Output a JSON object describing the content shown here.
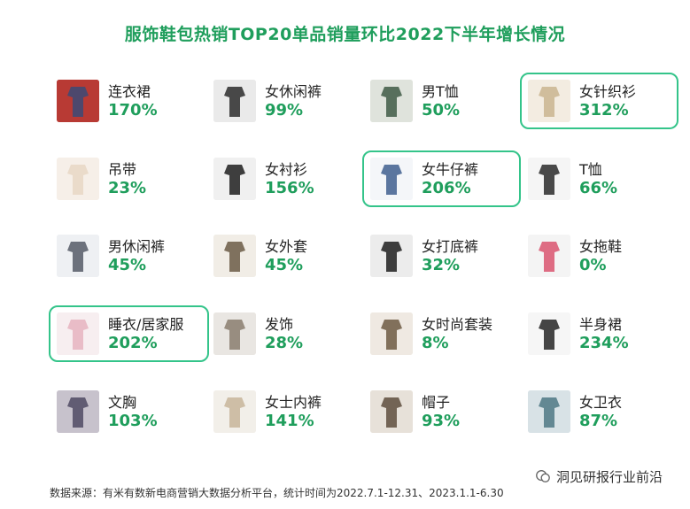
{
  "title": "服饰鞋包热销TOP20单品销量环比2022下半年增长情况",
  "chart_data": {
    "type": "table",
    "title": "服饰鞋包热销TOP20单品销量环比2022下半年增长情况",
    "items": [
      {
        "name": "连衣裙",
        "growth": "170%",
        "value": 170,
        "highlighted": false,
        "icon": "dress-icon"
      },
      {
        "name": "女休闲裤",
        "growth": "99%",
        "value": 99,
        "highlighted": false,
        "icon": "pants-icon"
      },
      {
        "name": "男T恤",
        "growth": "50%",
        "value": 50,
        "highlighted": false,
        "icon": "tshirt-icon"
      },
      {
        "name": "女针织衫",
        "growth": "312%",
        "value": 312,
        "highlighted": true,
        "icon": "knit-icon"
      },
      {
        "name": "吊带",
        "growth": "23%",
        "value": 23,
        "highlighted": false,
        "icon": "camisole-icon"
      },
      {
        "name": "女衬衫",
        "growth": "156%",
        "value": 156,
        "highlighted": false,
        "icon": "shirt-icon"
      },
      {
        "name": "女牛仔裤",
        "growth": "206%",
        "value": 206,
        "highlighted": true,
        "icon": "jeans-icon"
      },
      {
        "name": "T恤",
        "growth": "66%",
        "value": 66,
        "highlighted": false,
        "icon": "tshirts-icon"
      },
      {
        "name": "男休闲裤",
        "growth": "45%",
        "value": 45,
        "highlighted": false,
        "icon": "trousers-icon"
      },
      {
        "name": "女外套",
        "growth": "45%",
        "value": 45,
        "highlighted": false,
        "icon": "coat-icon"
      },
      {
        "name": "女打底裤",
        "growth": "32%",
        "value": 32,
        "highlighted": false,
        "icon": "leggings-icon"
      },
      {
        "name": "女拖鞋",
        "growth": "0%",
        "value": 0,
        "highlighted": false,
        "icon": "slipper-icon"
      },
      {
        "name": "睡衣/居家服",
        "growth": "202%",
        "value": 202,
        "highlighted": true,
        "icon": "pajamas-icon"
      },
      {
        "name": "发饰",
        "growth": "28%",
        "value": 28,
        "highlighted": false,
        "icon": "hair-accessory-icon"
      },
      {
        "name": "女时尚套装",
        "growth": "8%",
        "value": 8,
        "highlighted": false,
        "icon": "suit-icon"
      },
      {
        "name": "半身裙",
        "growth": "234%",
        "value": 234,
        "highlighted": false,
        "icon": "skirt-icon"
      },
      {
        "name": "文胸",
        "growth": "103%",
        "value": 103,
        "highlighted": false,
        "icon": "bra-icon"
      },
      {
        "name": "女士内裤",
        "growth": "141%",
        "value": 141,
        "highlighted": false,
        "icon": "underwear-icon"
      },
      {
        "name": "帽子",
        "growth": "93%",
        "value": 93,
        "highlighted": false,
        "icon": "hat-icon"
      },
      {
        "name": "女卫衣",
        "growth": "87%",
        "value": 87,
        "highlighted": false,
        "icon": "hoodie-icon"
      }
    ]
  },
  "footer": "数据来源：有米有数新电商营销大数据分析平台，统计时间为2022.7.1-12.31、2023.1.1-6.30",
  "watermark": "洞见研报行业前沿",
  "colors": {
    "accent": "#1f9e5c",
    "highlight_border": "#34c48a",
    "text": "#222222"
  }
}
